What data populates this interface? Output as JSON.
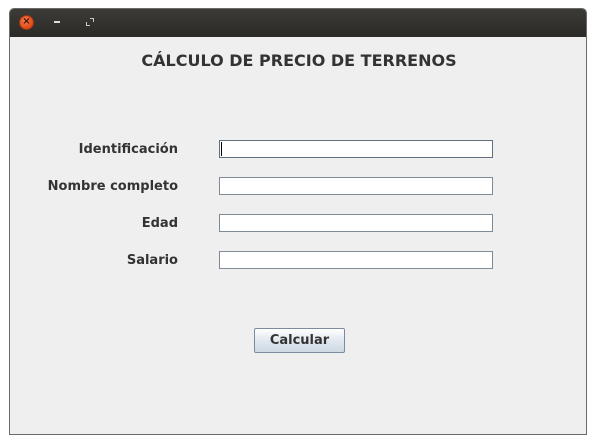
{
  "window": {
    "heading": "CÁLCULO DE PRECIO DE TERRENOS",
    "controls": {
      "close_icon": "close-icon",
      "minimize_icon": "minimize-icon",
      "maximize_icon": "maximize-icon"
    }
  },
  "form": {
    "fields": [
      {
        "label": "Identificación",
        "value": ""
      },
      {
        "label": "Nombre completo",
        "value": ""
      },
      {
        "label": "Edad",
        "value": ""
      },
      {
        "label": "Salario",
        "value": ""
      }
    ],
    "submit_label": "Calcular"
  },
  "colors": {
    "titlebar": "#3c3b37",
    "close_button": "#df4a16",
    "window_background": "#efefef"
  }
}
